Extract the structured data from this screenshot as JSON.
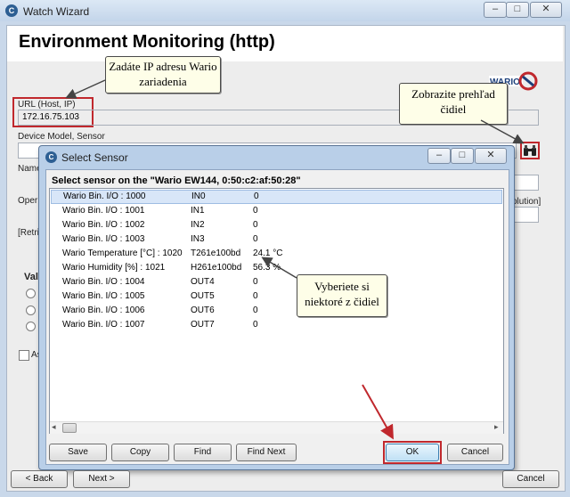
{
  "window": {
    "title": "Watch Wizard",
    "minimize": "–",
    "maximize": "□",
    "close": "✕"
  },
  "page": {
    "title": "Environment Monitoring (http)"
  },
  "callouts": {
    "ip": "Zadáte IP adresu Wario zariadenia",
    "overview": "Zobrazite prehľad čidiel",
    "select": "Vyberiete si niektoré z čidiel"
  },
  "logo": {
    "text": "WARIO"
  },
  "form": {
    "url_label": "URL (Host, IP)",
    "url_value": "172.16.75.103",
    "device_label": "Device Model, Sensor",
    "name_label": "Name",
    "oper_label": "Oper",
    "resolution_label": "olution]",
    "retri_label": "[Retri",
    "val_label": "Val",
    "as_label": "As"
  },
  "dialog": {
    "title": "Select Sensor",
    "heading": "Select sensor on the \"Wario EW144, 0:50:c2:af:50:28\"",
    "rows": [
      {
        "name": "Wario Bin. I/O : 1000",
        "id": "IN0",
        "value": "0"
      },
      {
        "name": "Wario Bin. I/O : 1001",
        "id": "IN1",
        "value": "0"
      },
      {
        "name": "Wario Bin. I/O : 1002",
        "id": "IN2",
        "value": "0"
      },
      {
        "name": "Wario Bin. I/O : 1003",
        "id": "IN3",
        "value": "0"
      },
      {
        "name": "Wario Temperature [°C] : 1020",
        "id": "T261e100bd",
        "value": "24.1 °C"
      },
      {
        "name": "Wario Humidity [%] : 1021",
        "id": "H261e100bd",
        "value": "56.3 %"
      },
      {
        "name": "Wario Bin. I/O : 1004",
        "id": "OUT4",
        "value": "0"
      },
      {
        "name": "Wario Bin. I/O : 1005",
        "id": "OUT5",
        "value": "0"
      },
      {
        "name": "Wario Bin. I/O : 1006",
        "id": "OUT6",
        "value": "0"
      },
      {
        "name": "Wario Bin. I/O : 1007",
        "id": "OUT7",
        "value": "0"
      }
    ],
    "buttons": {
      "save": "Save",
      "copy": "Copy",
      "find": "Find",
      "find_next": "Find Next",
      "ok": "OK",
      "cancel": "Cancel"
    }
  },
  "nav": {
    "back": "< Back",
    "next": "Next >",
    "cancel": "Cancel"
  },
  "colors": {
    "annotation_red": "#c0282d",
    "selection": "#d8e6f8"
  }
}
